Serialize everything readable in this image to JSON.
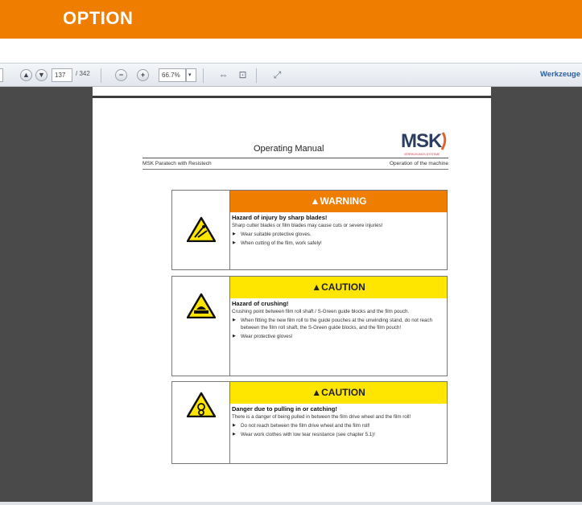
{
  "banner": {
    "title": "OPTION"
  },
  "toolbar": {
    "page_current": "137",
    "page_total": "/ 342",
    "zoom": "66.7%",
    "tools_label": "Werkzeuge"
  },
  "document": {
    "title": "Operating Manual",
    "logo_text": "MSK",
    "logo_sub": "VERPACKUNGS-SYSTEME",
    "header_left": "MSK Paratech with Resistech",
    "header_right": "Operation of the machine",
    "boxes": [
      {
        "severity": "WARNING",
        "title": "Hazard of injury by sharp blades!",
        "text": "Sharp cutter blades or film blades may cause cuts or severe injuries!",
        "bullets": [
          "Wear suitable protective gloves.",
          "When cutting of the film, work safely!"
        ]
      },
      {
        "severity": "CAUTION",
        "title": "Hazard of crushing!",
        "text": "Crushing point between film roll shaft / S-Green guide blocks and the film pouch.",
        "bullets": [
          "When fitting the new film roll to the guide pouches at the unwinding stand, do not reach between the film roll shaft, the S-Green guide blocks, and the film pouch!",
          "Wear protective gloves!"
        ]
      },
      {
        "severity": "CAUTION",
        "title": "Danger due to pulling in or catching!",
        "text": "There is a danger of being pulled in between the film drive wheel and the film roll!",
        "bullets": [
          "Do not reach between the film drive wheel and the film roll!",
          "Wear work clothes with low tear resistance (see chapter 5.1)!"
        ]
      }
    ]
  },
  "colors": {
    "banner": "#ee7d00",
    "warning": "#ee7d00",
    "caution": "#ffe600",
    "viewer_bg": "#4a4a4a"
  }
}
